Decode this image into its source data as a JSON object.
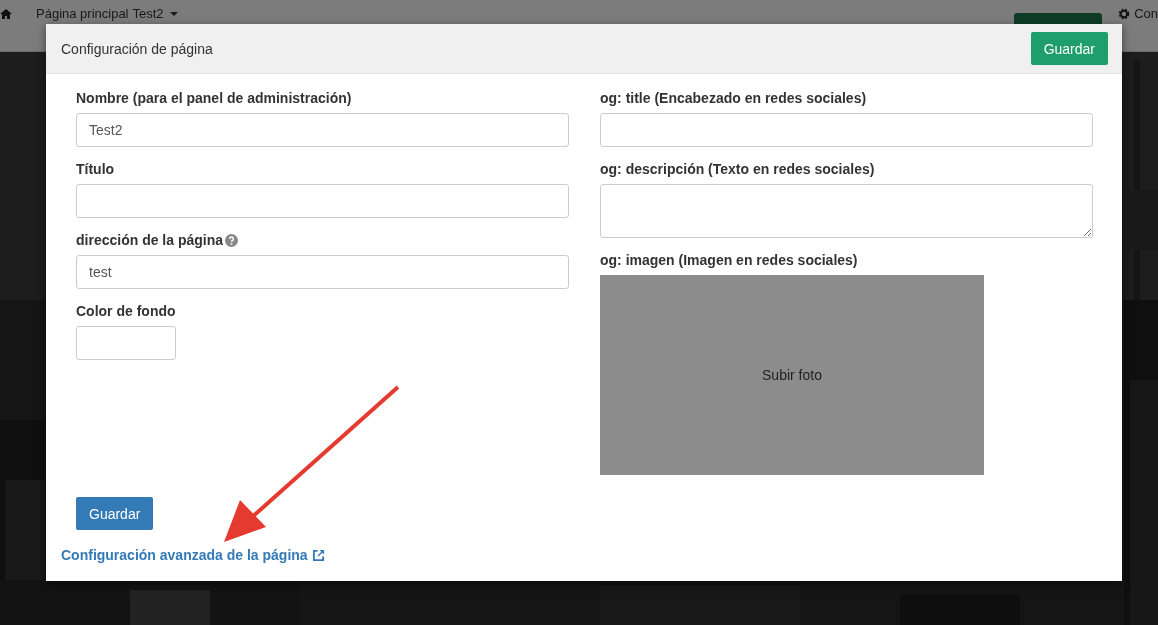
{
  "nav": {
    "items": [
      {
        "label": "Página principal",
        "kind": "home"
      },
      {
        "label": "Test2",
        "kind": "dropdown"
      }
    ],
    "settings_label": "Con"
  },
  "modal": {
    "title": "Configuración de página",
    "header_button": "Guardar",
    "left_fields": [
      {
        "kind": "text",
        "label": "Nombre (para el panel de administración)",
        "value": "Test2"
      },
      {
        "kind": "text",
        "label": "Título"
      },
      {
        "kind": "text",
        "label": "dirección de la página",
        "help": true,
        "value": "test"
      },
      {
        "kind": "color",
        "label": "Color de fondo"
      }
    ],
    "right_fields": [
      {
        "kind": "text",
        "label": "og: title (Encabezado en redes sociales)"
      },
      {
        "kind": "textarea",
        "label": "og: descripción (Texto en redes sociales)"
      },
      {
        "kind": "upload",
        "label": "og: imagen (Imagen en redes sociales)",
        "button": "Subir foto"
      }
    ],
    "save_button": "Guardar",
    "advanced_link": "Configuración avanzada de la página"
  }
}
